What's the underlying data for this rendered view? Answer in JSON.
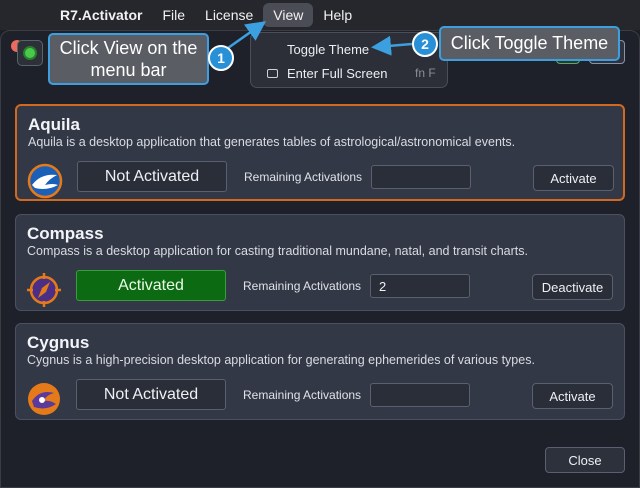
{
  "menubar": {
    "brand": "R7.Activator",
    "items": [
      "File",
      "License",
      "View",
      "Help"
    ]
  },
  "dropdown": {
    "items": [
      {
        "label": "Toggle Theme",
        "shortcut": ""
      },
      {
        "label": "Enter Full Screen",
        "shortcut": "fn F"
      }
    ]
  },
  "products": [
    {
      "name": "Aquila",
      "description": "Aquila is a desktop application that generates tables of astrological/astronomical events.",
      "status": "Not Activated",
      "remaining_label": "Remaining Activations",
      "remaining_value": "",
      "button": "Activate"
    },
    {
      "name": "Compass",
      "description": "Compass is a desktop application for casting traditional mundane, natal, and transit charts.",
      "status": "Activated",
      "remaining_label": "Remaining Activations",
      "remaining_value": "2",
      "button": "Deactivate"
    },
    {
      "name": "Cygnus",
      "description": "Cygnus is a high-precision desktop application for generating ephemerides of various types.",
      "status": "Not Activated",
      "remaining_label": "Remaining Activations",
      "remaining_value": "",
      "button": "Activate"
    }
  ],
  "close_label": "Close",
  "callouts": [
    {
      "number": "1",
      "text": "Click View on the menu bar"
    },
    {
      "number": "2",
      "text": "Click Toggle Theme"
    }
  ],
  "colors": {
    "accent_selected": "#d16a20",
    "activated_bg": "#0c6a12",
    "callout_border": "#3c9fe0"
  }
}
